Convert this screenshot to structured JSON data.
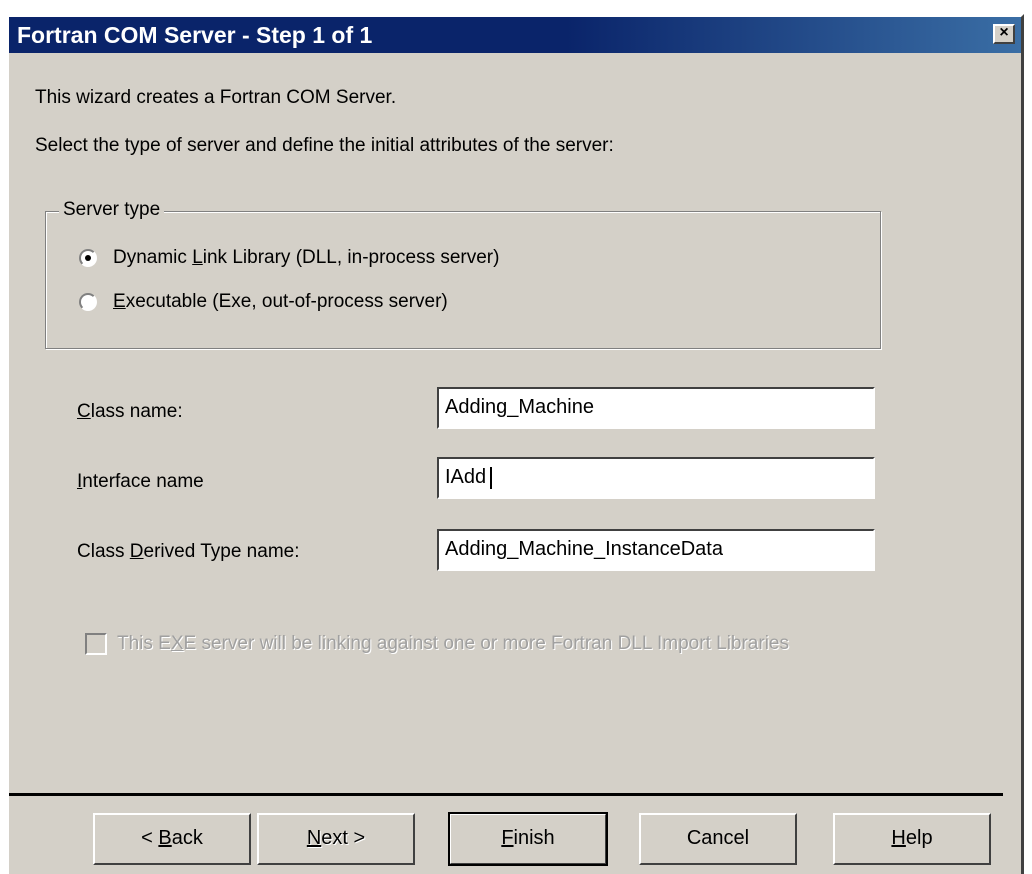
{
  "window": {
    "title": "Fortran COM Server - Step 1 of 1",
    "close_icon": "×"
  },
  "intro": {
    "line1": "This wizard creates a Fortran COM Server.",
    "line2": "Select the type of server and define the initial attributes of the server:"
  },
  "server_type": {
    "legend": "Server type",
    "options": [
      {
        "pre": "Dynamic ",
        "key": "L",
        "post": "ink Library (DLL, in-process server)",
        "selected": true
      },
      {
        "pre": "",
        "key": "E",
        "post": "xecutable (Exe, out-of-process server)",
        "selected": false
      }
    ]
  },
  "fields": {
    "class_name": {
      "pre": "",
      "key": "C",
      "post": "lass name:",
      "value": "Adding_Machine"
    },
    "interface_name": {
      "pre": "",
      "key": "I",
      "post": "nterface name",
      "value": "IAdd"
    },
    "derived_type": {
      "pre": "Class ",
      "key": "D",
      "post": "erived Type name:",
      "value": "Adding_Machine_InstanceData"
    }
  },
  "exe_checkbox": {
    "pre": "This E",
    "key": "X",
    "post": "E server will be linking against one or more Fortran DLL Import Libraries",
    "checked": false,
    "enabled": false
  },
  "buttons": {
    "back": {
      "pre": "< ",
      "key": "B",
      "post": "ack"
    },
    "next": {
      "pre": "",
      "key": "N",
      "post": "ext >"
    },
    "finish": {
      "pre": "",
      "key": "F",
      "post": "inish"
    },
    "cancel": {
      "label": "Cancel"
    },
    "help": {
      "pre": "",
      "key": "H",
      "post": "elp"
    }
  }
}
